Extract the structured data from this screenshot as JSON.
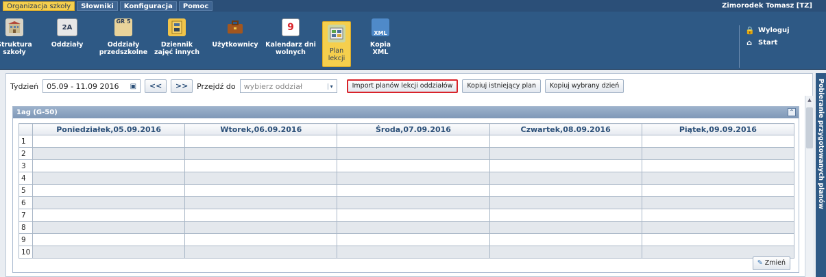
{
  "menu": [
    "Organizacja szkoły",
    "Słowniki",
    "Konfiguracja",
    "Pomoc"
  ],
  "user": "Zimorodek Tomasz [TZ]",
  "toolbar": [
    {
      "label": "Struktura\nszkoły",
      "icon": "building-icon"
    },
    {
      "label": "Oddziały",
      "icon": "class-2a-icon",
      "icon_text": "2A"
    },
    {
      "label": "Oddziały\nprzedszkolne",
      "icon": "preschool-icon",
      "icon_text": "GR 5"
    },
    {
      "label": "Dziennik\nzajęć innych",
      "icon": "journal-icon"
    },
    {
      "label": "Użytkownicy",
      "icon": "briefcase-icon"
    },
    {
      "label": "Kalendarz dni\nwolnych",
      "icon": "calendar-icon",
      "icon_text": "9"
    },
    {
      "label": "Plan\nlekcji",
      "icon": "schedule-icon",
      "selected": true
    },
    {
      "label": "Kopia\nXML",
      "icon": "xml-icon",
      "icon_text": "XML"
    }
  ],
  "links": [
    {
      "label": "Wyloguj",
      "icon": "lock-icon"
    },
    {
      "label": "Start",
      "icon": "home-icon"
    }
  ],
  "controls": {
    "week_label": "Tydzień",
    "week_value": "05.09 - 11.09 2016",
    "prev": "<<",
    "next": ">>",
    "goto_label": "Przejdź do",
    "goto_placeholder": "wybierz oddział",
    "import_button": "Import planów lekcji oddziałów",
    "copy_plan_button": "Kopiuj istniejący plan",
    "copy_day_button": "Kopiuj wybrany dzień"
  },
  "panel": {
    "title": "1ag (G-50)",
    "columns": [
      "Poniedziałek,05.09.2016",
      "Wtorek,06.09.2016",
      "Środa,07.09.2016",
      "Czwartek,08.09.2016",
      "Piątek,09.09.2016"
    ],
    "rows": [
      "1",
      "2",
      "3",
      "4",
      "5",
      "6",
      "7",
      "8",
      "9",
      "10"
    ],
    "edit_button": "Zmień"
  },
  "side_panel_label": "Pobieranie przygotowanych planów",
  "colors": {
    "bar": "#2b4f78",
    "accent": "#f5cf4d",
    "highlight_border": "#d9232a"
  }
}
